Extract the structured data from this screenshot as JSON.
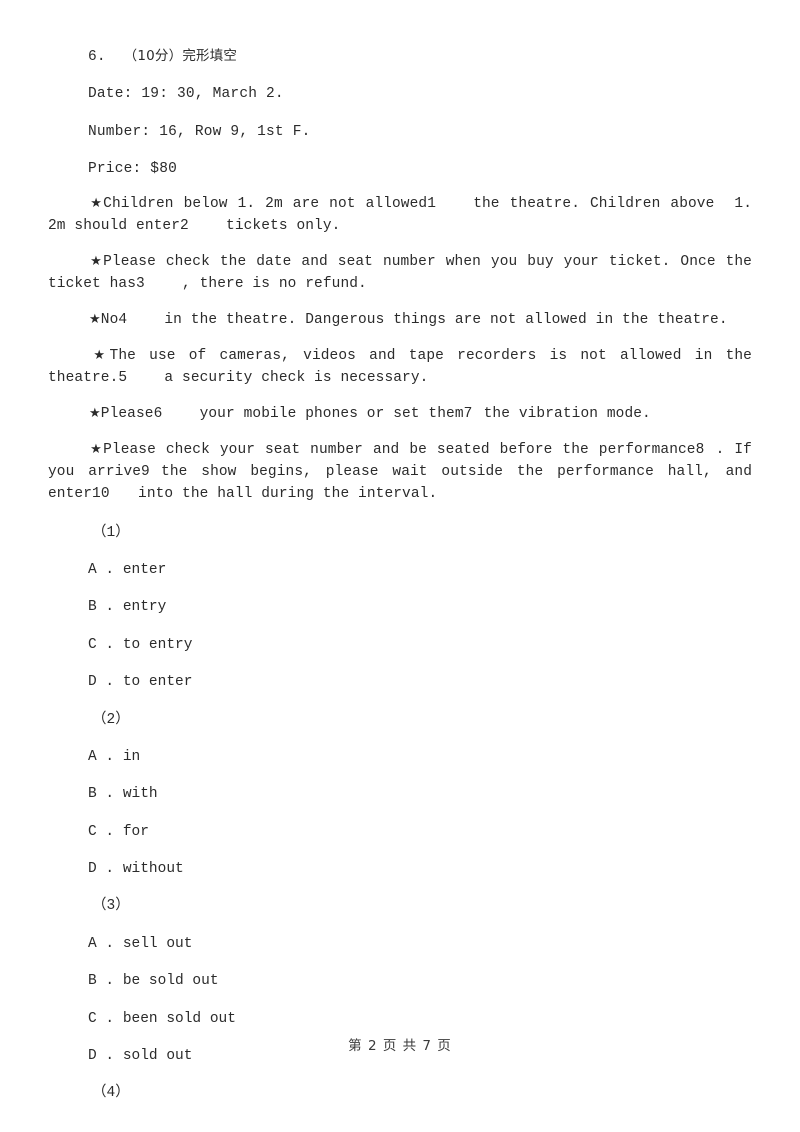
{
  "document": {
    "question_number": "6.",
    "question_score": "（10分）",
    "question_type": "完形填空",
    "info_lines": [
      "Date: 19: 30, March 2.",
      "Number: 16, Row 9, 1st F.",
      "Price: $80"
    ],
    "star_glyph": "★",
    "paragraphs": [
      {
        "id": "rule-1",
        "pre": "Children below 1. 2m are not allowed",
        "blank": "1",
        "mid": "the theatre. Children above  1. 2m should enter",
        "blank2": "2",
        "post": "tickets only."
      },
      {
        "id": "rule-2",
        "pre": "Please check the date and seat number when you buy your ticket. Once the ticket has",
        "blank": "3",
        "post": ", there is no refund."
      },
      {
        "id": "rule-3",
        "pre": "No",
        "blank": "4",
        "post": "in the theatre. Dangerous things are not allowed in the theatre."
      },
      {
        "id": "rule-4",
        "pre": "The use of cameras, videos and tape recorders is not allowed in the theatre.",
        "blank": "5",
        "post": "a security check is necessary."
      },
      {
        "id": "rule-5",
        "pre": "Please",
        "blank": "6",
        "mid": "your mobile phones or set them",
        "blank2": "7",
        "post": "the vibration mode."
      },
      {
        "id": "rule-6",
        "pre": "Please check your seat number and be seated before the performance",
        "blank": "8",
        "mid": ". If you arrive",
        "blank2": "9",
        "mid2": "the show begins, please wait outside the performance hall, and enter",
        "blank3": "10",
        "post": "into the hall during the interval."
      }
    ],
    "option_groups": [
      {
        "label": "（1）",
        "options": [
          {
            "letter": "A",
            "sep": " . ",
            "text": "enter"
          },
          {
            "letter": "B",
            "sep": " . ",
            "text": "entry"
          },
          {
            "letter": "C",
            "sep": " . ",
            "text": "to entry"
          },
          {
            "letter": "D",
            "sep": " . ",
            "text": "to enter"
          }
        ]
      },
      {
        "label": "（2）",
        "options": [
          {
            "letter": "A",
            "sep": " . ",
            "text": "in"
          },
          {
            "letter": "B",
            "sep": " . ",
            "text": "with"
          },
          {
            "letter": "C",
            "sep": " . ",
            "text": "for"
          },
          {
            "letter": "D",
            "sep": " . ",
            "text": "without"
          }
        ]
      },
      {
        "label": "（3）",
        "options": [
          {
            "letter": "A",
            "sep": " . ",
            "text": "sell out"
          },
          {
            "letter": "B",
            "sep": " . ",
            "text": "be sold out"
          },
          {
            "letter": "C",
            "sep": " . ",
            "text": "been sold out"
          },
          {
            "letter": "D",
            "sep": " . ",
            "text": "sold out"
          }
        ]
      },
      {
        "label": "（4）",
        "options": []
      }
    ],
    "footer": "第 2 页 共 7 页"
  }
}
